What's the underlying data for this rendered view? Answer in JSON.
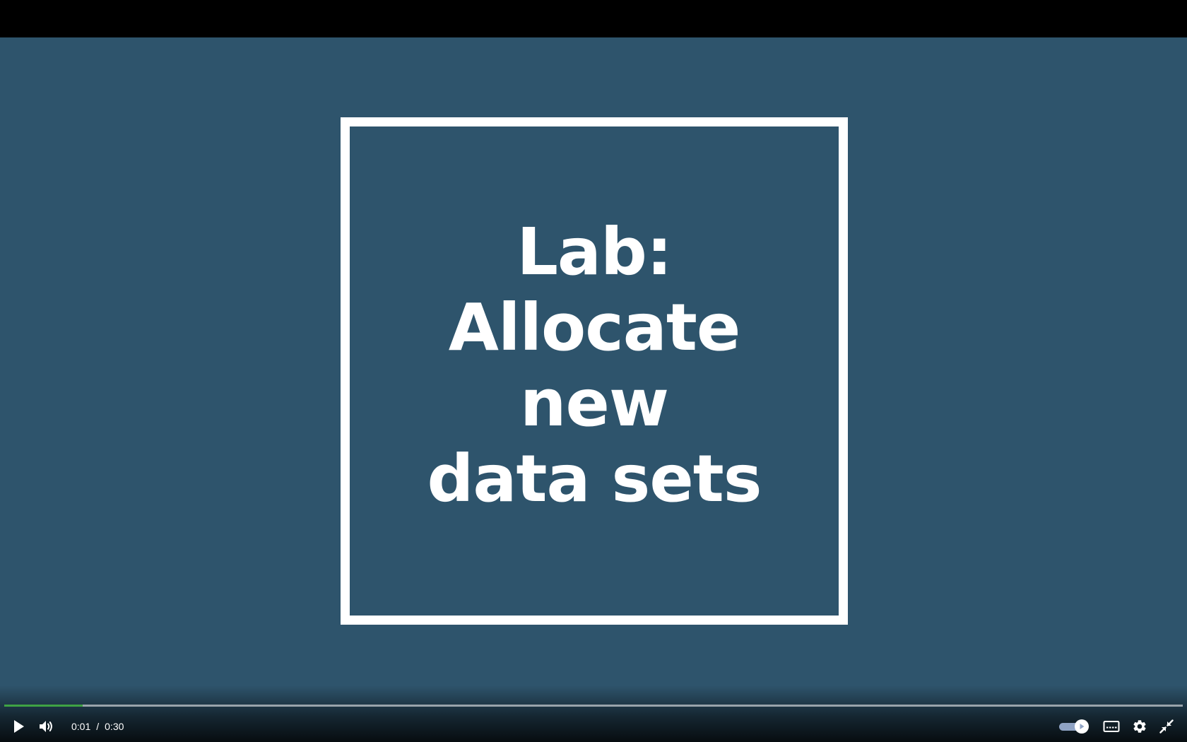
{
  "slide": {
    "title_lines": [
      "Lab:",
      "Allocate",
      "new",
      "data sets"
    ]
  },
  "player": {
    "current_time": "0:01",
    "separator": "/",
    "duration": "0:30",
    "progress_fraction": 0.0667,
    "autoplay_on": true,
    "colors": {
      "video_background": "#2e546c",
      "progress_played": "#3fa344",
      "toggle_track": "#8fa3c4"
    },
    "icons": {
      "play": "play-icon",
      "volume": "volume-icon",
      "autoplay": "autoplay-toggle",
      "captions": "captions-icon",
      "settings": "gear-icon",
      "exit_fullscreen": "exit-fullscreen-icon"
    }
  }
}
